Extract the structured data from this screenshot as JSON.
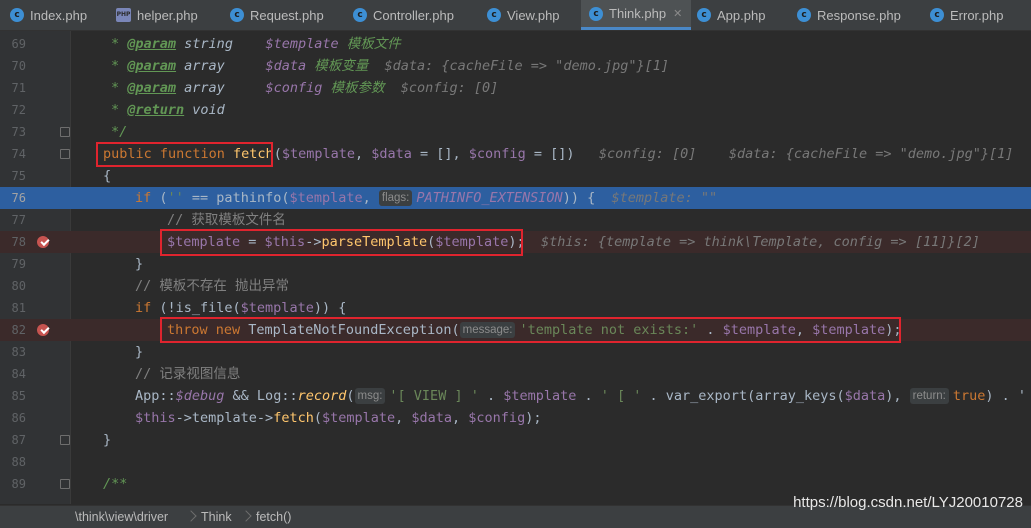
{
  "tabs": [
    {
      "label": "Index.php"
    },
    {
      "label": "helper.php"
    },
    {
      "label": "Request.php"
    },
    {
      "label": "Controller.php"
    },
    {
      "label": "View.php"
    },
    {
      "label": "Think.php"
    },
    {
      "label": "App.php"
    },
    {
      "label": "Response.php"
    },
    {
      "label": "Error.php"
    }
  ],
  "editor": {
    "line_numbers": [
      "69",
      "70",
      "71",
      "72",
      "73",
      "74",
      "75",
      "76",
      "77",
      "78",
      "79",
      "80",
      "81",
      "82",
      "83",
      "84",
      "85",
      "86",
      "87",
      "88",
      "89"
    ],
    "current_line": "76",
    "lines": {
      "l69": {
        "star": "* ",
        "tag": "@param",
        "type": " string",
        "name": "    $template",
        "desc": " 模板文件"
      },
      "l70": {
        "star": "* ",
        "tag": "@param",
        "type": " array",
        "name": "     $data",
        "desc": " 模板变量",
        "hint": "  $data: {cacheFile => \"demo.jpg\"}[1]"
      },
      "l71": {
        "star": "* ",
        "tag": "@param",
        "type": " array",
        "name": "     $config",
        "desc": " 模板参数",
        "hint": "  $config: [0]"
      },
      "l72": {
        "star": "* ",
        "tag": "@return",
        "type": " void"
      },
      "l73": {
        "text": "*/"
      },
      "l74": {
        "kw": "public function ",
        "fn": "fetch",
        "p1": "(",
        "a1": "$template",
        "p2": ", ",
        "a2": "$data",
        "p3": " = [], ",
        "a3": "$config",
        "p4": " = [])",
        "hint": "   $config: [0]    $data: {cacheFile => \"demo.jpg\"}[1]    $"
      },
      "l75": {
        "text": "{"
      },
      "l76": {
        "kw": "if",
        "p1": " (",
        "s1": "''",
        "p2": " == pathinfo(",
        "v1": "$template",
        "p3": ", ",
        "inlay": "flags:",
        "c1": "PATHINFO_EXTENSION",
        "p4": ")) {",
        "hint": "  $template: \"\""
      },
      "l77": {
        "text": "// 获取模板文件名"
      },
      "l78": {
        "v1": "$template",
        "p1": " = ",
        "v2": "$this",
        "p2": "->",
        "fn": "parseTemplate",
        "p3": "(",
        "v3": "$template",
        "p4": ");",
        "hint": "  $this: {template => think\\Template, config => [11]}[2]"
      },
      "l79": {
        "text": "}"
      },
      "l80": {
        "text": "// 模板不存在 抛出异常"
      },
      "l81": {
        "kw": "if",
        "p1": " (!is_file(",
        "v1": "$template",
        "p2": ")) {"
      },
      "l82": {
        "kw": "throw new ",
        "cls": "TemplateNotFoundException(",
        "inlay": "message:",
        "s1": "'template not exists:'",
        "p1": " . ",
        "v1": "$template",
        "p2": ", ",
        "v2": "$template",
        "p3": ");"
      },
      "l83": {
        "text": "}"
      },
      "l84": {
        "text": "// 记录视图信息"
      },
      "l85": {
        "p1": "App::",
        "v1": "$debug",
        "p2": " && Log::",
        "f1": "record",
        "p3": "(",
        "inlay1": "msg:",
        "s1": "'[ VIEW ] '",
        "p4": " . ",
        "v2": "$template",
        "p5": " . ",
        "s2": "' [ '",
        "p6": " . var_export(array_keys(",
        "v3": "$data",
        "p7": "), ",
        "inlay2": "return:",
        "k1": "true",
        "p8": ") . '"
      },
      "l86": {
        "v1": "$this",
        "p1": "->template->",
        "fn": "fetch",
        "p2": "(",
        "v2": "$template",
        "p3": ", ",
        "v3": "$data",
        "p4": ", ",
        "v4": "$config",
        "p5": ");"
      },
      "l87": {
        "text": "}"
      },
      "l88": {
        "text": ""
      },
      "l89": {
        "text": "/**"
      }
    }
  },
  "breadcrumb": [
    "\\think\\view\\driver",
    "Think",
    "fetch()"
  ],
  "watermark": "https://blog.csdn.net/LYJ20010728",
  "colors": {
    "accent": "#4a88c7",
    "highlight": "#2d5fa0",
    "breakpoint": "#c75450",
    "annotation_box": "#e0242e"
  }
}
